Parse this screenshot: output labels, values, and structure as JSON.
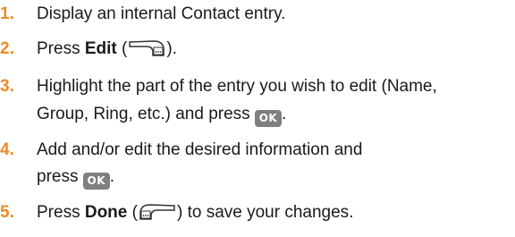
{
  "steps": [
    {
      "number": "1.",
      "text": "Display an internal Contact entry."
    },
    {
      "number": "2.",
      "pre": "Press ",
      "bold": "Edit",
      "open": " (",
      "close": ")."
    },
    {
      "number": "3.",
      "line1": "Highlight the part of the entry you wish to edit (Name,",
      "line2_pre": "Group, Ring, etc.) and press ",
      "line2_post": "."
    },
    {
      "number": "4.",
      "line1": "Add and/or edit the desired information and",
      "line2_pre": "press ",
      "line2_post": "."
    },
    {
      "number": "5.",
      "pre": "Press ",
      "bold": "Done",
      "open": " (",
      "close": ") to save your changes."
    }
  ],
  "ok_key_label": "OK",
  "icons": {
    "right_softkey": "right-softkey-icon",
    "left_softkey": "left-softkey-icon",
    "ok_key": "ok-key-icon"
  },
  "colors": {
    "step_number": "#f08a24",
    "ok_key_bg": "#7f7f7f"
  }
}
